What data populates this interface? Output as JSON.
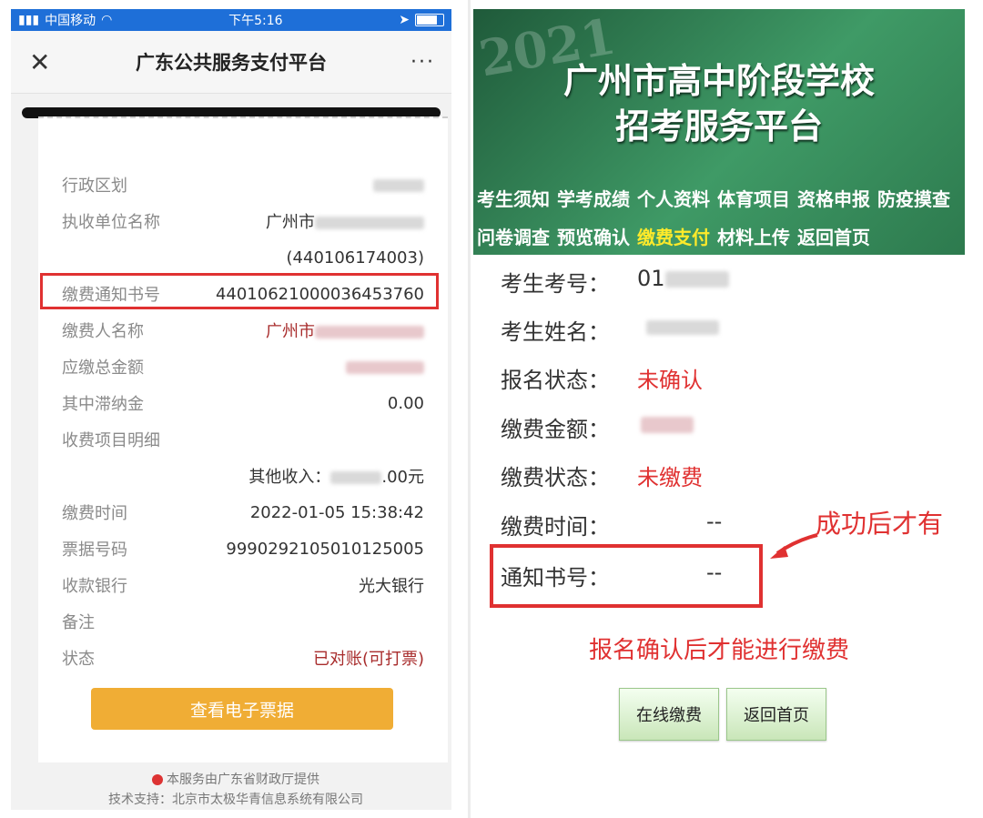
{
  "phone": {
    "status_bar": {
      "carrier": "中国移动",
      "time": "下午5:16"
    },
    "nav": {
      "close": "✕",
      "title": "广东公共服务支付平台",
      "more": "···"
    },
    "rows": [
      {
        "label": "行政区划",
        "value": ""
      },
      {
        "label": "执收单位名称",
        "value": "广州市"
      },
      {
        "label": "",
        "value": "(440106174003)"
      },
      {
        "label": "缴费通知书号",
        "value": "44010621000036453760"
      },
      {
        "label": "缴费人名称",
        "value": "广州市"
      },
      {
        "label": "应缴总金额",
        "value": ""
      },
      {
        "label": "其中滞纳金",
        "value": "0.00"
      },
      {
        "label": "收费项目明细",
        "value": ""
      },
      {
        "label": "",
        "value": "其他收入：",
        "suffix": ".00元"
      },
      {
        "label": "缴费时间",
        "value": "2022-01-05 15:38:42"
      },
      {
        "label": "票据号码",
        "value": "9990292105010125005"
      },
      {
        "label": "收款银行",
        "value": "光大银行"
      },
      {
        "label": "备注",
        "value": ""
      },
      {
        "label": "状态",
        "value": "已对账(可打票)"
      }
    ],
    "ticket_button": "查看电子票据",
    "footer": {
      "line1": "本服务由广东省财政厅提供",
      "line2": "技术支持：北京市太极华青信息系统有限公司"
    }
  },
  "portal": {
    "year": "2021",
    "title_line1": "广州市高中阶段学校",
    "title_line2": "招考服务平台",
    "menu_row1": [
      "考生须知",
      "学考成绩",
      "个人资料",
      "体育项目",
      "资格申报",
      "防疫摸查"
    ],
    "menu_row2": [
      "问卷调查",
      "预览确认",
      "缴费支付",
      "材料上传",
      "返回首页"
    ],
    "fields": [
      {
        "label": "考生考号：",
        "value": "01"
      },
      {
        "label": "考生姓名：",
        "value": ""
      },
      {
        "label": "报名状态：",
        "value": "未确认"
      },
      {
        "label": "缴费金额：",
        "value": ""
      },
      {
        "label": "缴费状态：",
        "value": "未缴费"
      },
      {
        "label": "缴费时间：",
        "value": "--"
      },
      {
        "label": "通知书号：",
        "value": "--"
      }
    ],
    "annotation": "成功后才有",
    "warning": "报名确认后才能进行缴费",
    "pay_button": "在线缴费",
    "home_button": "返回首页"
  },
  "colors": {
    "accent_red": "#e03131",
    "banner_green": "#2d7a4e",
    "menu_active": "#ffea2a",
    "ticket_orange": "#f0ad35"
  }
}
